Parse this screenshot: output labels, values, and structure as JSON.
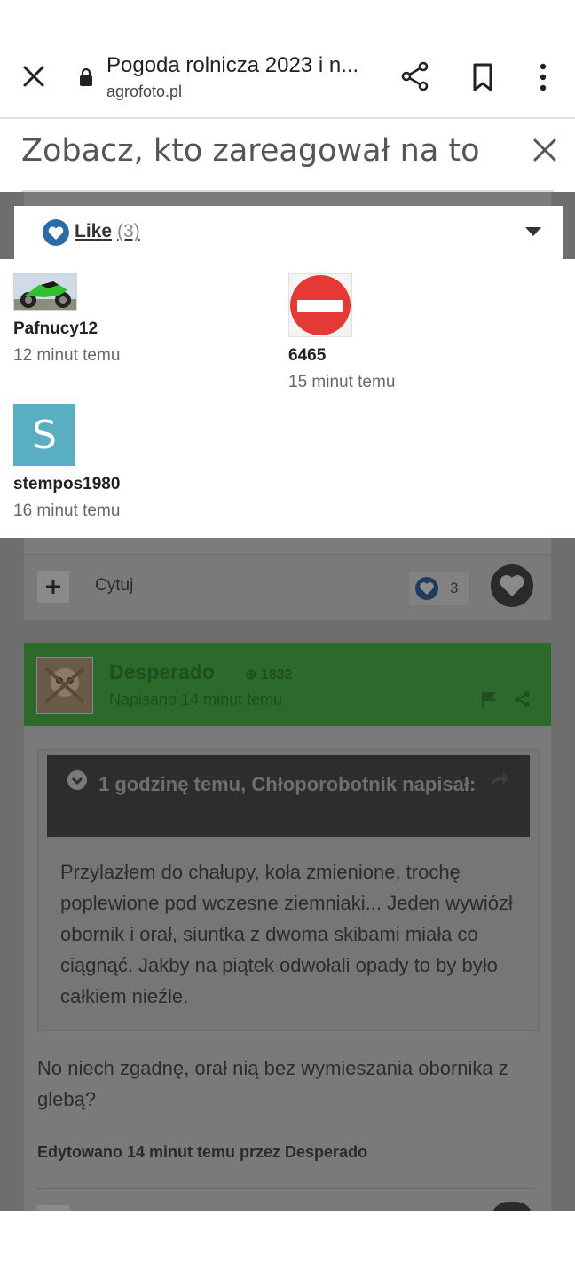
{
  "browser": {
    "page_title": "Pogoda rolnicza 2023 i n...",
    "domain": "agrofoto.pl"
  },
  "dialog": {
    "title": "Zobacz, kto zareagował na to",
    "tab": {
      "label": "Like",
      "count": "(3)"
    }
  },
  "reactors": [
    {
      "name": "Pafnucy12",
      "time": "12 minut temu"
    },
    {
      "name": "6465",
      "time": "15 minut temu"
    },
    {
      "name": "stempos1980",
      "time": "16 minut temu",
      "avatar_letter": "S"
    }
  ],
  "background_post": {
    "quote_label": "Cytuj",
    "reaction_count": "3",
    "author": "Desperado",
    "author_rep": "1832",
    "posted": "Napisano 14 minut temu",
    "quote_header": "1 godzinę temu, Chłoporobotnik napisał:",
    "quote_text": "Przylazłem do chałupy, koła zmienione, trochę poplewione pod wczesne ziemniaki... Jeden wywiózł obornik i orał, siuntka z dwoma skibami miała co ciągnąć. Jakby na piątek odwołali opady to by było całkiem nieźle.",
    "reply_text": "No niech zgadnę, orał nią bez wymieszania obornika z glebą?",
    "edited": "Edytowano 14 minut temu przez Desperado"
  },
  "colors": {
    "like_blue": "#2b6ca8",
    "author_green": "#3aa338",
    "no_entry_red": "#e53935",
    "avatar_s_bg": "#5aaec4"
  }
}
